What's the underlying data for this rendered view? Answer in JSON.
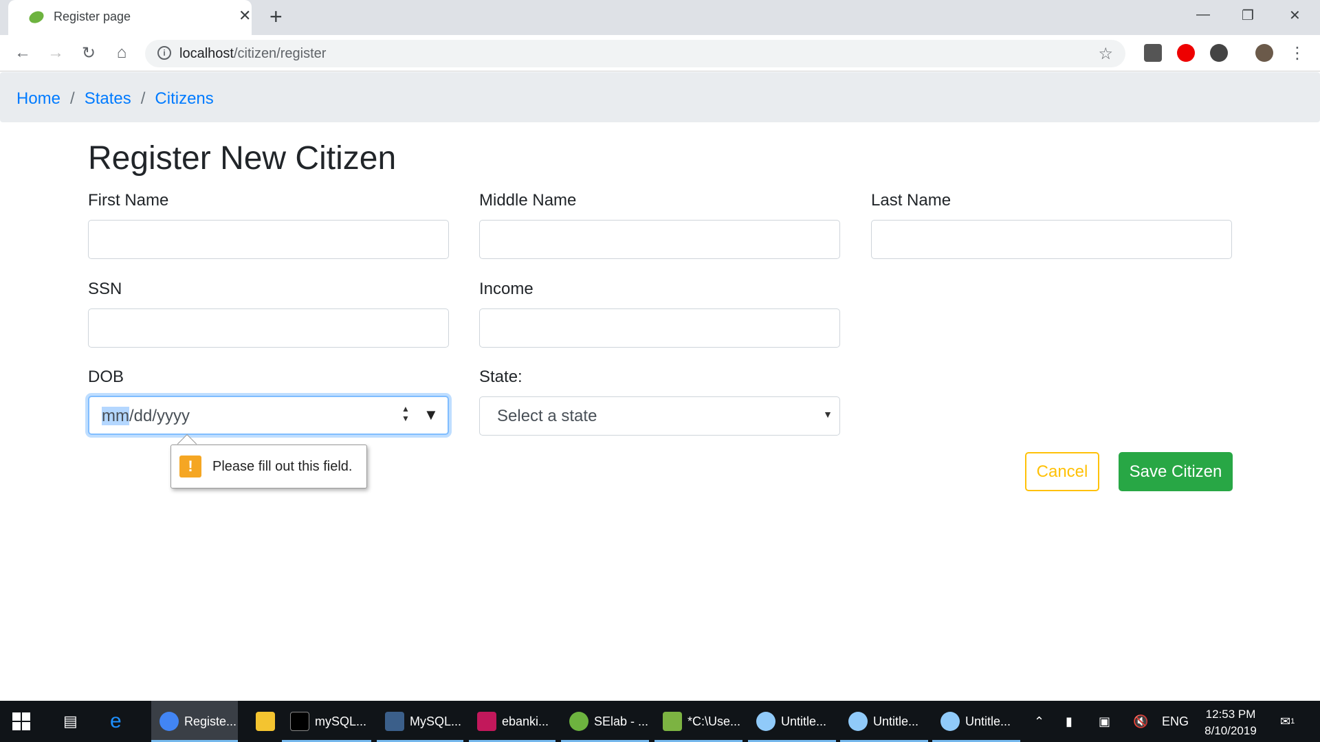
{
  "browser": {
    "tab_title": "Register page",
    "url_host": "localhost",
    "url_path": "/citizen/register",
    "new_tab": "+",
    "close": "✕",
    "minimize": "—",
    "restore": "❐",
    "win_close": "✕"
  },
  "breadcrumb": {
    "items": [
      "Home",
      "States",
      "Citizens"
    ],
    "separator": "/"
  },
  "form": {
    "title": "Register New Citizen",
    "first_name_label": "First Name",
    "middle_name_label": "Middle Name",
    "last_name_label": "Last Name",
    "ssn_label": "SSN",
    "income_label": "Income",
    "dob_label": "DOB",
    "dob_placeholder_selected": "mm",
    "dob_placeholder_rest": "/dd/yyyy",
    "state_label": "State:",
    "state_selected": "Select a state",
    "validation_message": "Please fill out this field.",
    "cancel_label": "Cancel",
    "save_label": "Save Citizen"
  },
  "taskbar": {
    "items": [
      "Registe...",
      "mySQL...",
      "MySQL...",
      "ebanki...",
      "SElab - ...",
      "*C:\\Use...",
      "Untitle...",
      "Untitle...",
      "Untitle..."
    ],
    "lang": "ENG",
    "time": "12:53 PM",
    "date": "8/10/2019",
    "notifications": "1"
  },
  "colors": {
    "primary": "#007bff",
    "success": "#28a745",
    "warning": "#ffc107"
  }
}
